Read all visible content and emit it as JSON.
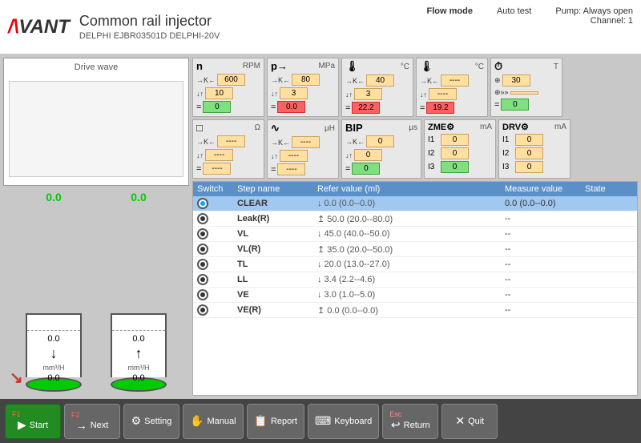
{
  "header": {
    "logo": "AVANT",
    "title": "Common rail injector",
    "subtitle": "DELPHI EJBR03501D  DELPHI-20V",
    "mode": "Flow mode",
    "auto_test": "Auto test",
    "pump": "Pump: Always open",
    "channel": "Channel: 1"
  },
  "drive_wave": {
    "label": "Drive wave"
  },
  "cylinders": [
    {
      "top_val": "0.0",
      "mid_val": "0.0",
      "unit": "mm³/H",
      "bottom_val": "0.0"
    },
    {
      "top_val": "0.0",
      "mid_val": "0.0",
      "unit": "mm³/H",
      "bottom_val": "0.0"
    }
  ],
  "controls": {
    "row1": [
      {
        "id": "n",
        "symbol": "n",
        "unit": "RPM",
        "rows": [
          {
            "arrow": "→K←",
            "value": "600",
            "type": "yellow"
          },
          {
            "arrow": "↓↑",
            "value": "10",
            "type": "yellow"
          },
          {
            "eq": "=",
            "value": "0",
            "type": "green"
          }
        ]
      },
      {
        "id": "p",
        "symbol": "p→",
        "unit": "MPa",
        "rows": [
          {
            "arrow": "→K←",
            "value": "80",
            "type": "yellow"
          },
          {
            "arrow": "↓↑",
            "value": "3",
            "type": "yellow"
          },
          {
            "eq": "=",
            "value": "0.0",
            "type": "red"
          }
        ]
      },
      {
        "id": "temp1",
        "symbol": "🌡",
        "unit": "°C",
        "rows": [
          {
            "arrow": "→K←",
            "value": "40",
            "type": "yellow"
          },
          {
            "arrow": "↓↑",
            "value": "3",
            "type": "yellow"
          },
          {
            "eq": "=",
            "value": "22.2",
            "type": "red"
          }
        ]
      },
      {
        "id": "temp2",
        "symbol": "🌡",
        "unit": "°C",
        "rows": [
          {
            "arrow": "→K←",
            "value": "----",
            "type": "yellow"
          },
          {
            "arrow": "↓↑",
            "value": "----",
            "type": "yellow"
          },
          {
            "eq": "=",
            "value": "19.2",
            "type": "red"
          }
        ]
      },
      {
        "id": "timer",
        "symbol": "⏱",
        "unit": "T",
        "rows": [
          {
            "arrow": "⊕",
            "value": "30",
            "type": "yellow"
          },
          {
            "arrow": "⊕»»",
            "value": "",
            "type": "yellow"
          },
          {
            "eq": "=",
            "value": "0",
            "type": "green"
          }
        ]
      }
    ],
    "row2": [
      {
        "id": "resistance",
        "symbol": "□",
        "unit": "Ω",
        "rows": [
          {
            "arrow": "→K←",
            "value": "----",
            "type": "yellow"
          },
          {
            "arrow": "↓↑",
            "value": "----",
            "type": "yellow"
          },
          {
            "eq": "=",
            "value": "----",
            "type": "yellow"
          }
        ]
      },
      {
        "id": "inductance",
        "symbol": "∿",
        "unit": "μH",
        "rows": [
          {
            "arrow": "→K←",
            "value": "----",
            "type": "yellow"
          },
          {
            "arrow": "↓↑",
            "value": "----",
            "type": "yellow"
          },
          {
            "eq": "=",
            "value": "----",
            "type": "yellow"
          }
        ]
      },
      {
        "id": "bip",
        "symbol": "BIP",
        "unit": "μs",
        "rows": [
          {
            "arrow": "→K←",
            "value": "0",
            "type": "yellow"
          },
          {
            "arrow": "↓↑",
            "value": "0",
            "type": "yellow"
          },
          {
            "eq": "=",
            "value": "0",
            "type": "green"
          }
        ]
      },
      {
        "id": "zme",
        "symbol": "ZME",
        "unit": "mA",
        "rows": [
          {
            "label": "I1",
            "value": "0",
            "type": "yellow"
          },
          {
            "label": "I2",
            "value": "0",
            "type": "yellow"
          },
          {
            "label": "I3",
            "value": "0",
            "type": "green"
          }
        ]
      },
      {
        "id": "drv",
        "symbol": "DRV",
        "unit": "mA",
        "rows": [
          {
            "label": "I1",
            "value": "0",
            "type": "yellow"
          },
          {
            "label": "I2",
            "value": "0",
            "type": "yellow"
          },
          {
            "label": "I3",
            "value": "0",
            "type": "yellow"
          }
        ]
      }
    ]
  },
  "table": {
    "headers": [
      "Switch",
      "Step name",
      "Refer value (ml)",
      "Measure value",
      "State"
    ],
    "rows": [
      {
        "selected": true,
        "name": "CLEAR",
        "refer": "↓ 0.0 (0.0--0.0)",
        "measure": "0.0 (0.0--0.0)",
        "state": ""
      },
      {
        "selected": false,
        "name": "Leak(R)",
        "refer": "↥ 50.0 (20.0--80.0)",
        "measure": "--",
        "state": ""
      },
      {
        "selected": false,
        "name": "VL",
        "refer": "↓ 45.0 (40.0--50.0)",
        "measure": "--",
        "state": ""
      },
      {
        "selected": false,
        "name": "VL(R)",
        "refer": "↥ 35.0 (20.0--50.0)",
        "measure": "--",
        "state": ""
      },
      {
        "selected": false,
        "name": "TL",
        "refer": "↓ 20.0 (13.0--27.0)",
        "measure": "--",
        "state": ""
      },
      {
        "selected": false,
        "name": "LL",
        "refer": "↓ 3.4 (2.2--4.6)",
        "measure": "--",
        "state": ""
      },
      {
        "selected": false,
        "name": "VE",
        "refer": "↓ 3.0 (1.0--5.0)",
        "measure": "--",
        "state": ""
      },
      {
        "selected": false,
        "name": "VE(R)",
        "refer": "↥ 0.0 (0.0--0.0)",
        "measure": "--",
        "state": ""
      }
    ]
  },
  "toolbar": {
    "buttons": [
      {
        "fn": "F1",
        "icon": "▶",
        "label": "Start",
        "type": "start"
      },
      {
        "fn": "F2",
        "icon": "→",
        "label": "Next",
        "type": "normal"
      },
      {
        "fn": "",
        "icon": "⚙",
        "label": "Setting",
        "type": "normal"
      },
      {
        "fn": "",
        "icon": "✋",
        "label": "Manual",
        "type": "normal"
      },
      {
        "fn": "",
        "icon": "📋",
        "label": "Report",
        "type": "normal"
      },
      {
        "fn": "",
        "icon": "⌨",
        "label": "Keyboard",
        "type": "normal"
      },
      {
        "fn": "Esc",
        "icon": "↩",
        "label": "Return",
        "type": "normal"
      },
      {
        "fn": "",
        "icon": "✕",
        "label": "Quit",
        "type": "normal"
      }
    ]
  }
}
